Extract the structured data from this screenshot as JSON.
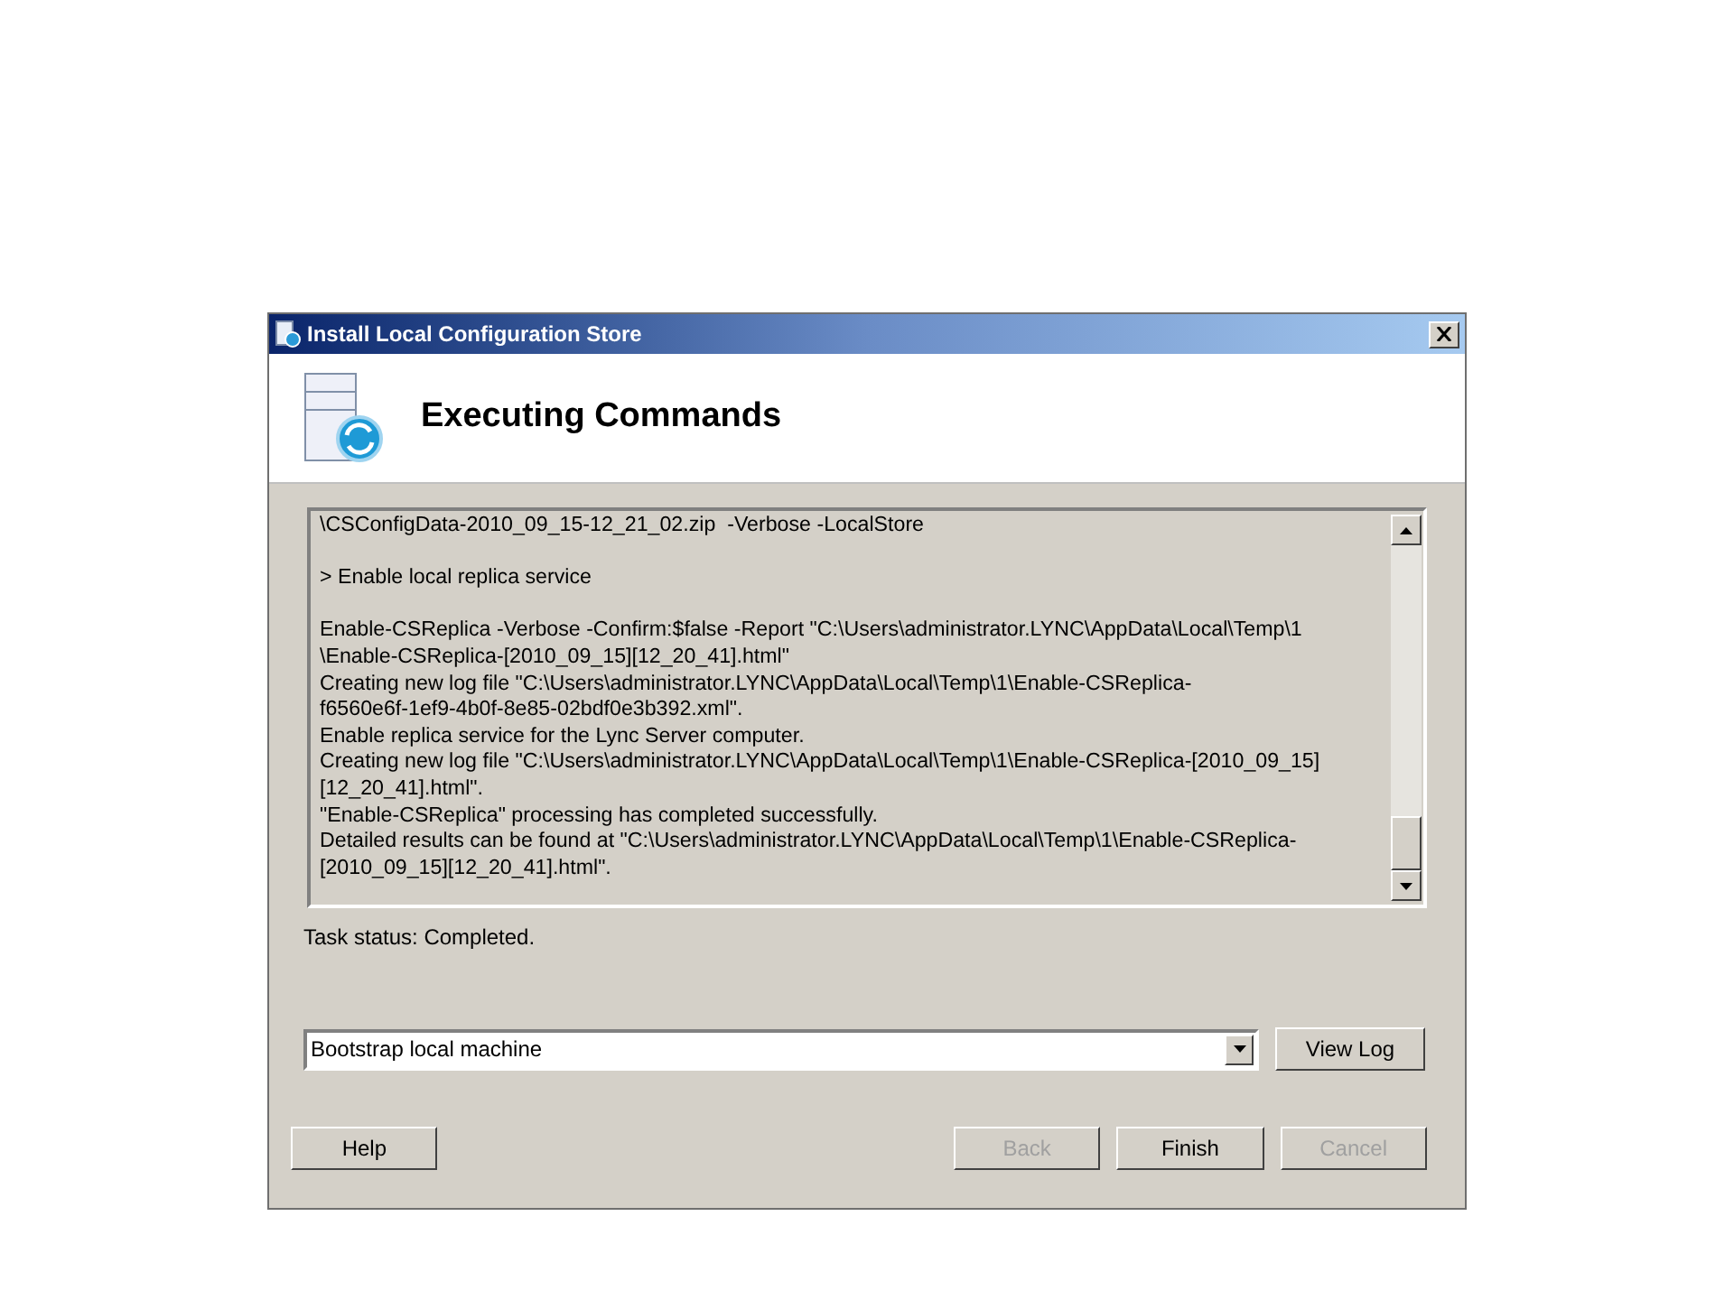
{
  "window": {
    "title": "Install Local Configuration Store"
  },
  "header": {
    "title": "Executing Commands"
  },
  "log": {
    "groups": [
      [
        "\\CSConfigData-2010_09_15-12_21_02.zip  -Verbose -LocalStore"
      ],
      [
        "> Enable local replica service"
      ],
      [
        "Enable-CSReplica -Verbose -Confirm:$false -Report \"C:\\Users\\administrator.LYNC\\AppData\\Local\\Temp\\1",
        "\\Enable-CSReplica-[2010_09_15][12_20_41].html\"",
        "Creating new log file \"C:\\Users\\administrator.LYNC\\AppData\\Local\\Temp\\1\\Enable-CSReplica-",
        "f6560e6f-1ef9-4b0f-8e85-02bdf0e3b392.xml\".",
        "Enable replica service for the Lync Server computer.",
        "Creating new log file \"C:\\Users\\administrator.LYNC\\AppData\\Local\\Temp\\1\\Enable-CSReplica-[2010_09_15]",
        "[12_20_41].html\".",
        "\"Enable-CSReplica\" processing has completed successfully.",
        "Detailed results can be found at \"C:\\Users\\administrator.LYNC\\AppData\\Local\\Temp\\1\\Enable-CSReplica-",
        "[2010_09_15][12_20_41].html\"."
      ]
    ]
  },
  "task_status": "Task status: Completed.",
  "task_select": {
    "value": "Bootstrap local machine"
  },
  "view_log_button": {
    "label": "View Log",
    "disabled": false
  },
  "buttons": [
    {
      "label": "Help",
      "disabled": false
    },
    {
      "label": "Back",
      "disabled": true
    },
    {
      "label": "Finish",
      "disabled": false
    },
    {
      "label": "Cancel",
      "disabled": true
    }
  ]
}
